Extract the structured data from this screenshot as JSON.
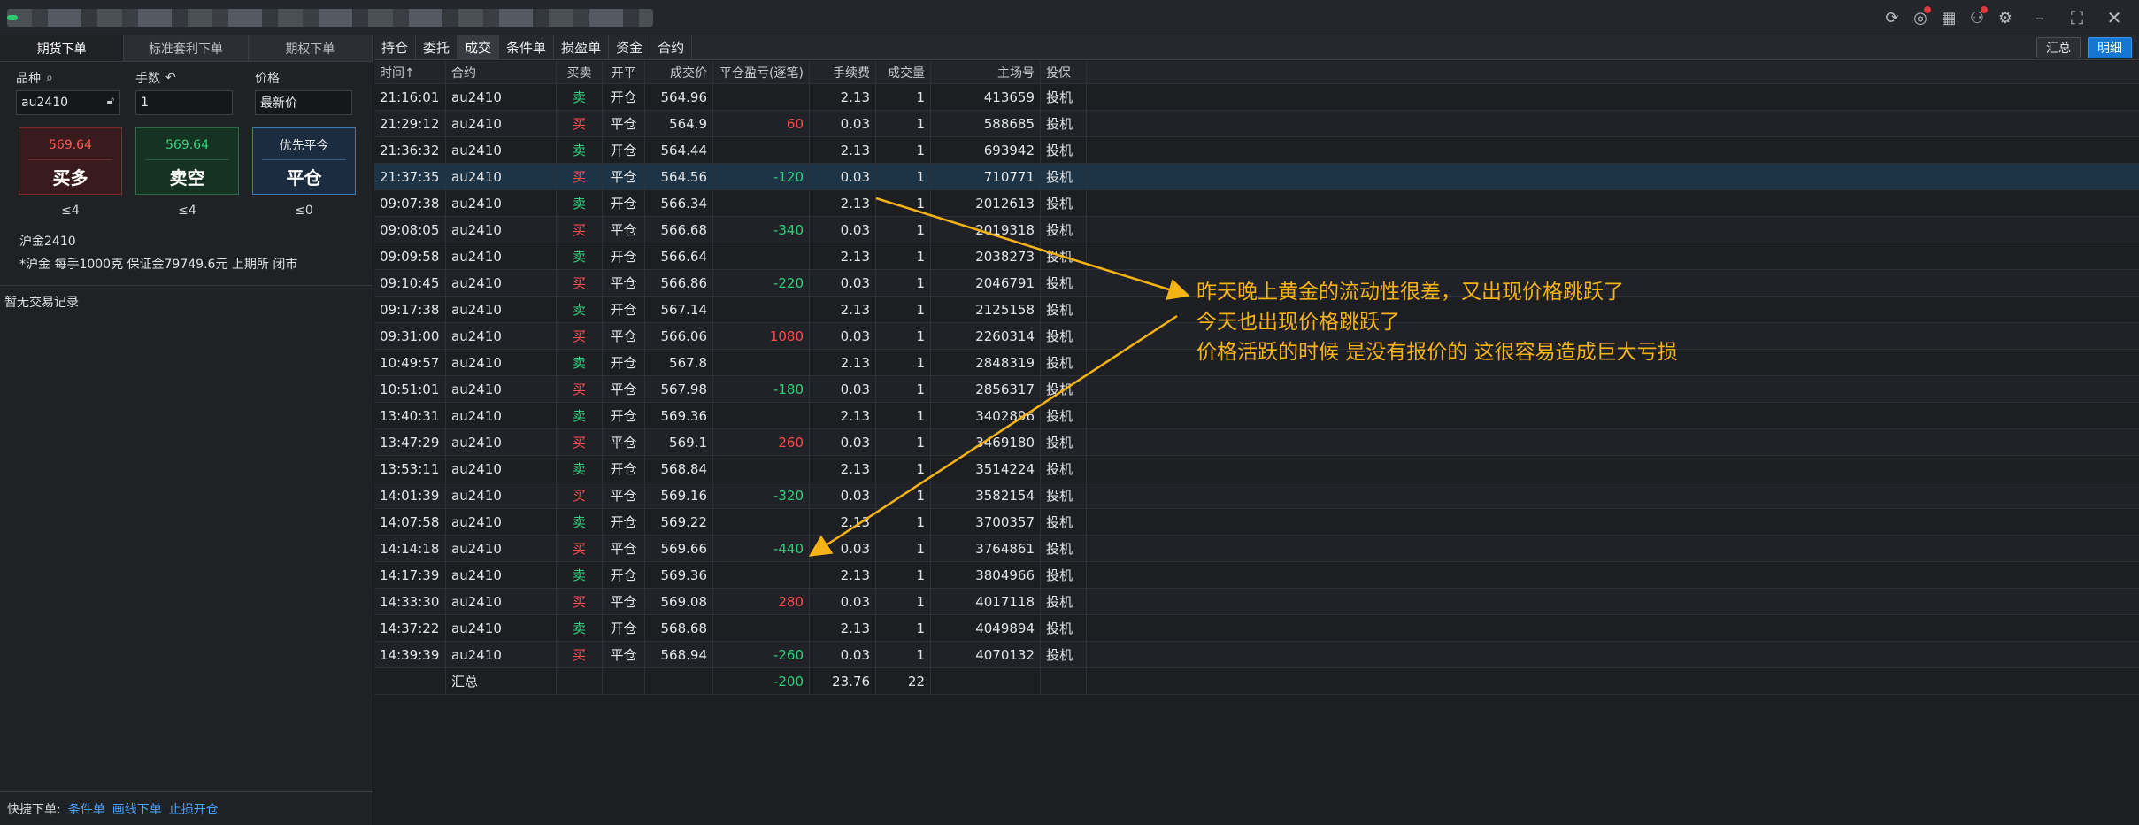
{
  "window": {
    "toolbar_icons": [
      "refresh-icon",
      "message-icon",
      "calendar-icon",
      "user-settings-icon",
      "gear-icon"
    ],
    "controls": [
      "minimize-icon",
      "maximize-icon",
      "close-icon"
    ]
  },
  "sidebar": {
    "tabs": [
      {
        "label": "期货下单",
        "active": true
      },
      {
        "label": "标准套利下单",
        "active": false
      },
      {
        "label": "期权下单",
        "active": false
      }
    ],
    "instrument_label": "品种",
    "instrument_value": "au2410",
    "qty_label": "手数",
    "qty_value": "1",
    "price_label": "价格",
    "price_value": "最新价",
    "buy_price": "569.64",
    "buy_label": "买多",
    "sell_price": "569.64",
    "sell_label": "卖空",
    "close_top": "优先平今",
    "close_label": "平仓",
    "buy_limit": "≤4",
    "sell_limit": "≤4",
    "close_limit": "≤0",
    "contract_name": "沪金2410",
    "contract_info": "*沪金 每手1000克 保证金79749.6元 上期所 闭市",
    "no_record": "暂无交易记录",
    "quick_label": "快捷下单:",
    "quick_links": [
      "条件单",
      "画线下单",
      "止损开仓"
    ]
  },
  "main": {
    "tabs": [
      {
        "label": "持仓",
        "active": false
      },
      {
        "label": "委托",
        "active": false
      },
      {
        "label": "成交",
        "active": true
      },
      {
        "label": "条件单",
        "active": false
      },
      {
        "label": "损盈单",
        "active": false
      },
      {
        "label": "资金",
        "active": false
      },
      {
        "label": "合约",
        "active": false
      }
    ],
    "view_summary": "汇总",
    "view_detail": "明细",
    "columns": [
      "时间↑",
      "合约",
      "买卖",
      "开平",
      "成交价",
      "平仓盈亏(逐笔)",
      "手续费",
      "成交量",
      "主场号",
      "投保"
    ],
    "rows": [
      [
        "21:16:01",
        "au2410",
        "卖",
        "开仓",
        "564.96",
        "",
        "2.13",
        "1",
        "413659",
        "投机"
      ],
      [
        "21:29:12",
        "au2410",
        "买",
        "平仓",
        "564.9",
        "60",
        "0.03",
        "1",
        "588685",
        "投机"
      ],
      [
        "21:36:32",
        "au2410",
        "卖",
        "开仓",
        "564.44",
        "",
        "2.13",
        "1",
        "693942",
        "投机"
      ],
      [
        "21:37:35",
        "au2410",
        "买",
        "平仓",
        "564.56",
        "-120",
        "0.03",
        "1",
        "710771",
        "投机"
      ],
      [
        "09:07:38",
        "au2410",
        "卖",
        "开仓",
        "566.34",
        "",
        "2.13",
        "1",
        "2012613",
        "投机"
      ],
      [
        "09:08:05",
        "au2410",
        "买",
        "平仓",
        "566.68",
        "-340",
        "0.03",
        "1",
        "2019318",
        "投机"
      ],
      [
        "09:09:58",
        "au2410",
        "卖",
        "开仓",
        "566.64",
        "",
        "2.13",
        "1",
        "2038273",
        "投机"
      ],
      [
        "09:10:45",
        "au2410",
        "买",
        "平仓",
        "566.86",
        "-220",
        "0.03",
        "1",
        "2046791",
        "投机"
      ],
      [
        "09:17:38",
        "au2410",
        "卖",
        "开仓",
        "567.14",
        "",
        "2.13",
        "1",
        "2125158",
        "投机"
      ],
      [
        "09:31:00",
        "au2410",
        "买",
        "平仓",
        "566.06",
        "1080",
        "0.03",
        "1",
        "2260314",
        "投机"
      ],
      [
        "10:49:57",
        "au2410",
        "卖",
        "开仓",
        "567.8",
        "",
        "2.13",
        "1",
        "2848319",
        "投机"
      ],
      [
        "10:51:01",
        "au2410",
        "买",
        "平仓",
        "567.98",
        "-180",
        "0.03",
        "1",
        "2856317",
        "投机"
      ],
      [
        "13:40:31",
        "au2410",
        "卖",
        "开仓",
        "569.36",
        "",
        "2.13",
        "1",
        "3402896",
        "投机"
      ],
      [
        "13:47:29",
        "au2410",
        "买",
        "平仓",
        "569.1",
        "260",
        "0.03",
        "1",
        "3469180",
        "投机"
      ],
      [
        "13:53:11",
        "au2410",
        "卖",
        "开仓",
        "568.84",
        "",
        "2.13",
        "1",
        "3514224",
        "投机"
      ],
      [
        "14:01:39",
        "au2410",
        "买",
        "平仓",
        "569.16",
        "-320",
        "0.03",
        "1",
        "3582154",
        "投机"
      ],
      [
        "14:07:58",
        "au2410",
        "卖",
        "开仓",
        "569.22",
        "",
        "2.13",
        "1",
        "3700357",
        "投机"
      ],
      [
        "14:14:18",
        "au2410",
        "买",
        "平仓",
        "569.66",
        "-440",
        "0.03",
        "1",
        "3764861",
        "投机"
      ],
      [
        "14:17:39",
        "au2410",
        "卖",
        "开仓",
        "569.36",
        "",
        "2.13",
        "1",
        "3804966",
        "投机"
      ],
      [
        "14:33:30",
        "au2410",
        "买",
        "平仓",
        "569.08",
        "280",
        "0.03",
        "1",
        "4017118",
        "投机"
      ],
      [
        "14:37:22",
        "au2410",
        "卖",
        "开仓",
        "568.68",
        "",
        "2.13",
        "1",
        "4049894",
        "投机"
      ],
      [
        "14:39:39",
        "au2410",
        "买",
        "平仓",
        "568.94",
        "-260",
        "0.03",
        "1",
        "4070132",
        "投机"
      ]
    ],
    "selected_row": 3,
    "total_label": "汇总",
    "total_pnl": "-200",
    "total_fee": "23.76",
    "total_qty": "22"
  },
  "annotation": {
    "color": "#f5b315",
    "lines": [
      "昨天晚上黄金的流动性很差，又出现价格跳跃了",
      "今天也出现价格跳跃了",
      "价格活跃的时候 是没有报价的 这很容易造成巨大亏损"
    ]
  }
}
